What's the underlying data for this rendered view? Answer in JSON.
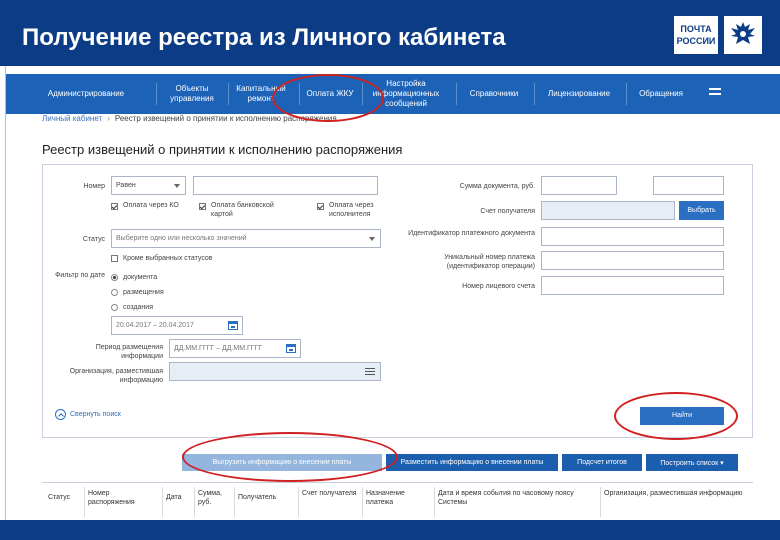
{
  "slide": {
    "title": "Получение реестра из Личного кабинета",
    "logo": {
      "line1": "ПОЧТА",
      "line2": "РОССИИ"
    }
  },
  "nav": {
    "items": [
      {
        "label": "Администрирование"
      },
      {
        "label": "Объекты управления"
      },
      {
        "label": "Капитальный ремонт"
      },
      {
        "label": "Оплата ЖКУ"
      },
      {
        "label": "Настройка информационных сообщений"
      },
      {
        "label": "Справочники"
      },
      {
        "label": "Лицензирование"
      },
      {
        "label": "Обращения"
      }
    ],
    "menu_icon": "hamburger-icon"
  },
  "breadcrumb": {
    "home": "Личный кабинет",
    "separator": "›",
    "current": "Реестр извещений о принятии к исполнению распоряжения"
  },
  "page_title": "Реестр извещений о принятии к исполнению распоряжения",
  "form": {
    "number_label": "Номер",
    "number_select": "Равен",
    "checkboxes": [
      {
        "label": "Оплата через КО",
        "checked": true
      },
      {
        "label": "Оплата банковской картой",
        "checked": true
      },
      {
        "label": "Оплата через исполнителя",
        "checked": true
      }
    ],
    "status_label": "Статус",
    "status_placeholder": "Выберите одно или несколько значений",
    "except_label": "Кроме выбранных статусов",
    "date_filter_label": "Фильтр по дате",
    "radios": [
      {
        "label": "документа",
        "checked": true
      },
      {
        "label": "размещения",
        "checked": false
      },
      {
        "label": "создания",
        "checked": false
      }
    ],
    "date_range": "20.04.2017 – 20.04.2017",
    "period_label": "Период размещения информации",
    "period_placeholder": "ДД.ММ.ГГГГ – ДД.ММ.ГГГГ",
    "org_label": "Организация, разместившая информацию",
    "amount_label": "Сумма документа, руб.",
    "account_label": "Счет получателя",
    "choose_button": "Выбрать",
    "payment_id_label": "Идентификатор платежного документа",
    "unique_number_label": "Уникальный номер платежа (идентификатор операции)",
    "fee_account_label": "Номер лицевого счета",
    "collapse_label": "Свернуть поиск",
    "find_button": "Найти"
  },
  "actions": {
    "upload": "Выгрузить информацию о внесении платы",
    "deposit": "Разместить информацию о внесении платы",
    "summary": "Подсчет итогов",
    "build_list": "Построить список ▾"
  },
  "table": {
    "columns": [
      "Статус",
      "Номер распоряжения",
      "Дата",
      "Сумма, руб.",
      "Получатель",
      "Счет получателя",
      "Назначение платежа",
      "Дата и время события по часовому поясу Системы",
      "Организация, разместившая информацию"
    ]
  },
  "colors": {
    "header_navy": "#0c3c85",
    "nav_blue": "#1c63b8",
    "button_blue": "#2a6fc2",
    "annotation_red": "#d02020"
  }
}
